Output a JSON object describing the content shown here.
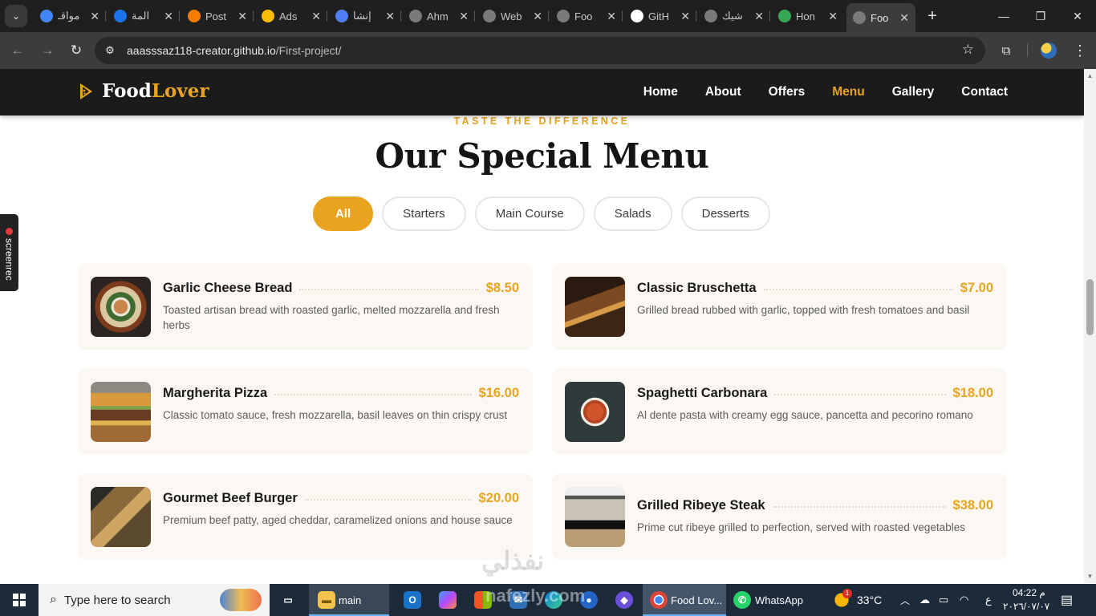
{
  "browser": {
    "tabs": [
      {
        "title": "مواقـ",
        "icon": "google-icon",
        "color": "#4285f4"
      },
      {
        "title": "المة",
        "icon": "tashkeel-icon",
        "color": "#1a73e8"
      },
      {
        "title": "Post",
        "icon": "blogger-icon",
        "color": "#f57c00"
      },
      {
        "title": "Ads",
        "icon": "google-ads-icon",
        "color": "#fbbc04"
      },
      {
        "title": "إنشا",
        "icon": "gemini-icon",
        "color": "#4f7df5"
      },
      {
        "title": "Ahm",
        "icon": "globe-icon",
        "color": "#7a7a7a"
      },
      {
        "title": "Web",
        "icon": "globe-icon",
        "color": "#7a7a7a"
      },
      {
        "title": "Foo",
        "icon": "globe-icon",
        "color": "#7a7a7a"
      },
      {
        "title": "GitH",
        "icon": "github-icon",
        "color": "#ffffff"
      },
      {
        "title": "شيك",
        "icon": "globe-icon",
        "color": "#7a7a7a"
      },
      {
        "title": "Hon",
        "icon": "google-drive-icon",
        "color": "#34a853"
      },
      {
        "title": "Foo",
        "icon": "globe-icon",
        "color": "#7a7a7a"
      }
    ],
    "url_host": "aaasssaz118-creator.github.io",
    "url_path": "/First-project/"
  },
  "site": {
    "brand_part1": "Food",
    "brand_part2": "Lover",
    "nav": [
      "Home",
      "About",
      "Offers",
      "Menu",
      "Gallery",
      "Contact"
    ],
    "nav_active": "Menu",
    "eyebrow": "TASTE THE DIFFERENCE",
    "heading": "Our Special Menu",
    "filters": [
      "All",
      "Starters",
      "Main Course",
      "Salads",
      "Desserts"
    ],
    "filter_active": "All",
    "accent_color": "#e8a41f",
    "items": [
      {
        "name": "Garlic Cheese Bread",
        "price": "$8.50",
        "desc": "Toasted artisan bread with roasted garlic, melted mozzarella and fresh herbs",
        "image": "pizza-photo"
      },
      {
        "name": "Classic Bruschetta",
        "price": "$7.00",
        "desc": "Grilled bread rubbed with garlic, topped with fresh tomatoes and basil",
        "image": "bruschetta-photo"
      },
      {
        "name": "Margherita Pizza",
        "price": "$16.00",
        "desc": "Classic tomato sauce, fresh mozzarella, basil leaves on thin crispy crust",
        "image": "burger-photo"
      },
      {
        "name": "Spaghetti Carbonara",
        "price": "$18.00",
        "desc": "Al dente pasta with creamy egg sauce, pancetta and pecorino romano",
        "image": "soup-bowl-photo"
      },
      {
        "name": "Gourmet Beef Burger",
        "price": "$20.00",
        "desc": "Premium beef patty, aged cheddar, caramelized onions and house sauce",
        "image": "taco-photo"
      },
      {
        "name": "Grilled Ribeye Steak",
        "price": "$38.00",
        "desc": "Prime cut ribeye grilled to perfection, served with roasted vegetables",
        "image": "kitchen-photo"
      }
    ]
  },
  "overlay": {
    "screenrec_label": "screenrec",
    "watermark_ar": "نفذلي",
    "watermark_en": "nafezly.com"
  },
  "taskbar": {
    "search_placeholder": "Type here to search",
    "explorer_label": "main",
    "chrome_label": "Food Lov...",
    "whatsapp_label": "WhatsApp",
    "weather": "33°C",
    "weather_badge": "1",
    "lang": "ع",
    "time": "04:22 م",
    "date": "٢٠٢٦/٠٧/٠٧"
  }
}
